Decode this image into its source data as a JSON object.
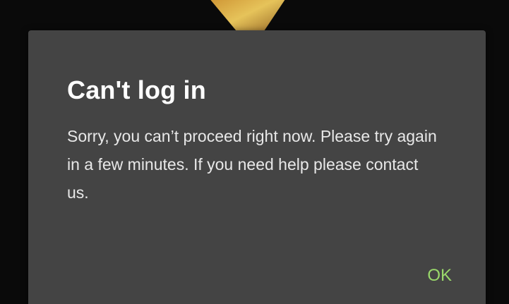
{
  "dialog": {
    "title": "Can't log in",
    "message": "Sorry, you can’t proceed right now. Please try again in a few minutes. If you need help please contact us.",
    "ok_label": "OK"
  },
  "colors": {
    "dialog_background": "#444444",
    "accent": "#9ad96b",
    "backdrop": "#0a0a0a"
  }
}
